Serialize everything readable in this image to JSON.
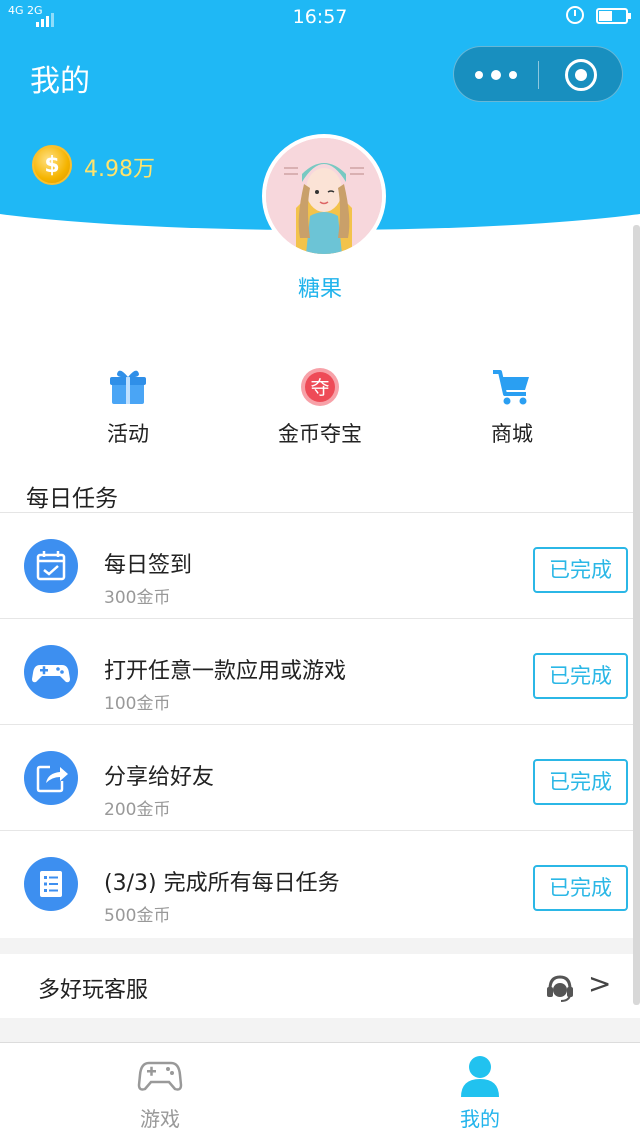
{
  "status_bar": {
    "network": "4G 2G",
    "time": "16:57",
    "battery_level": 0.5
  },
  "header": {
    "title": "我的"
  },
  "profile": {
    "coins": "4.98万",
    "nickname": "糖果"
  },
  "shortcuts": [
    {
      "label": "活动",
      "icon": "gift-icon"
    },
    {
      "label": "金币夺宝",
      "icon": "treasure-icon",
      "glyph": "夺"
    },
    {
      "label": "商城",
      "icon": "cart-icon"
    }
  ],
  "daily_tasks": {
    "title": "每日任务",
    "items": [
      {
        "name": "每日签到",
        "reward": "300金币",
        "status": "已完成",
        "icon": "calendar-check-icon"
      },
      {
        "name": "打开任意一款应用或游戏",
        "reward": "100金币",
        "status": "已完成",
        "icon": "gamepad-icon"
      },
      {
        "name": "分享给好友",
        "reward": "200金币",
        "status": "已完成",
        "icon": "share-icon"
      },
      {
        "name": "(3/3) 完成所有每日任务",
        "reward": "500金币",
        "status": "已完成",
        "icon": "list-icon"
      }
    ]
  },
  "service": {
    "label": "多好玩客服",
    "chevron": ">"
  },
  "tabbar": {
    "tabs": [
      {
        "label": "游戏",
        "active": false
      },
      {
        "label": "我的",
        "active": true
      }
    ]
  },
  "colors": {
    "primary": "#1fb8f5",
    "accent_text": "#22b4ec",
    "button_border": "#2bb7e6",
    "coin_text": "#ffe36b",
    "task_icon": "#3d8ff0",
    "treasure": "#ee4b57",
    "tab_inactive": "#999999"
  }
}
